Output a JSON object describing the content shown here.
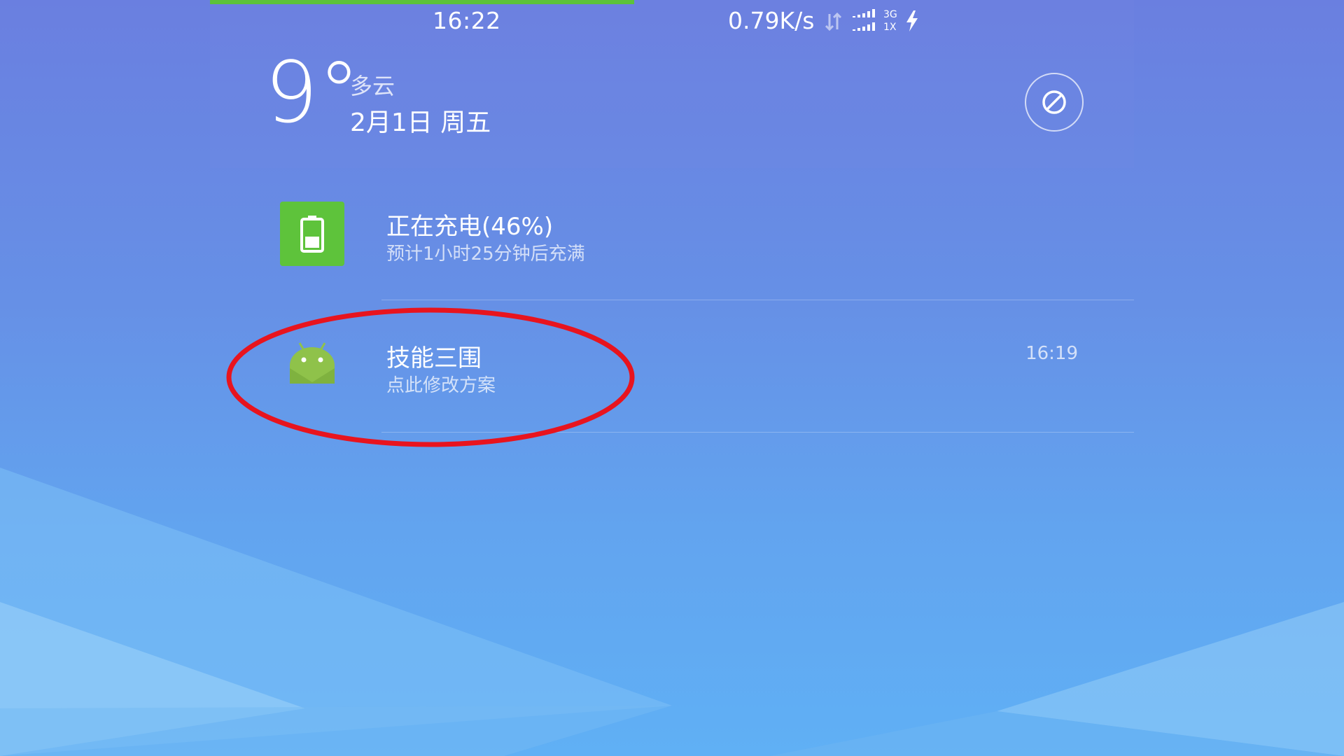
{
  "status_bar": {
    "time": "16:22",
    "net_speed": "0.79K/s",
    "net_type_top": "3G",
    "net_type_bottom": "1X",
    "icons": [
      "data-arrows-icon",
      "signal-icon",
      "signal-icon",
      "charge-icon"
    ],
    "progress_strip_color": "#5cc23a"
  },
  "weather": {
    "temperature": "9°",
    "condition": "多云",
    "date": "2月1日 周五",
    "dnd_icon": "do-not-disturb-icon"
  },
  "notifications": [
    {
      "icon": "battery-icon",
      "title": "正在充电(46%)",
      "subtitle": "预计1小时25分钟后充满",
      "icon_color": "#5ec33b"
    },
    {
      "icon": "android-icon",
      "title": "技能三围",
      "subtitle": "点此修改方案",
      "time": "16:19",
      "icon_color": "#8fc24a"
    }
  ],
  "annotation": {
    "color": "#e8141e",
    "target": "notification-app"
  }
}
